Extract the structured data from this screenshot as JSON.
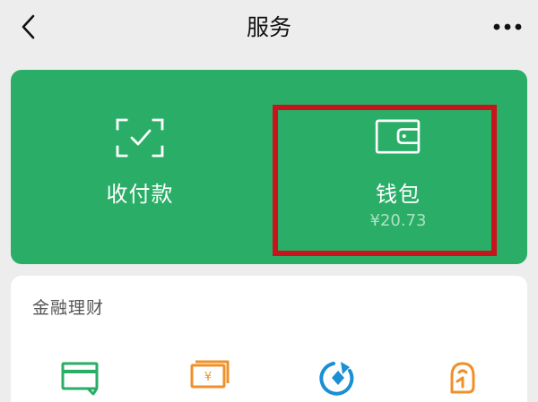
{
  "nav": {
    "title": "服务",
    "back_icon": "chevron-left-icon",
    "more_icon": "more-dots-icon"
  },
  "wallet_panel": {
    "background": "#2aae67",
    "pay": {
      "label": "收付款",
      "icon": "scan-check-icon"
    },
    "wallet": {
      "label": "钱包",
      "balance": "¥20.73",
      "icon": "wallet-icon"
    },
    "highlight_color": "#c8141c"
  },
  "finance": {
    "title": "金融理财",
    "items": [
      {
        "icon": "credit-card-icon",
        "color": "#2aae67"
      },
      {
        "icon": "banknote-yen-icon",
        "color": "#f0902a"
      },
      {
        "icon": "wealth-circle-icon",
        "color": "#1a8fd6"
      },
      {
        "icon": "insurance-figure-icon",
        "color": "#f0902a"
      }
    ]
  }
}
